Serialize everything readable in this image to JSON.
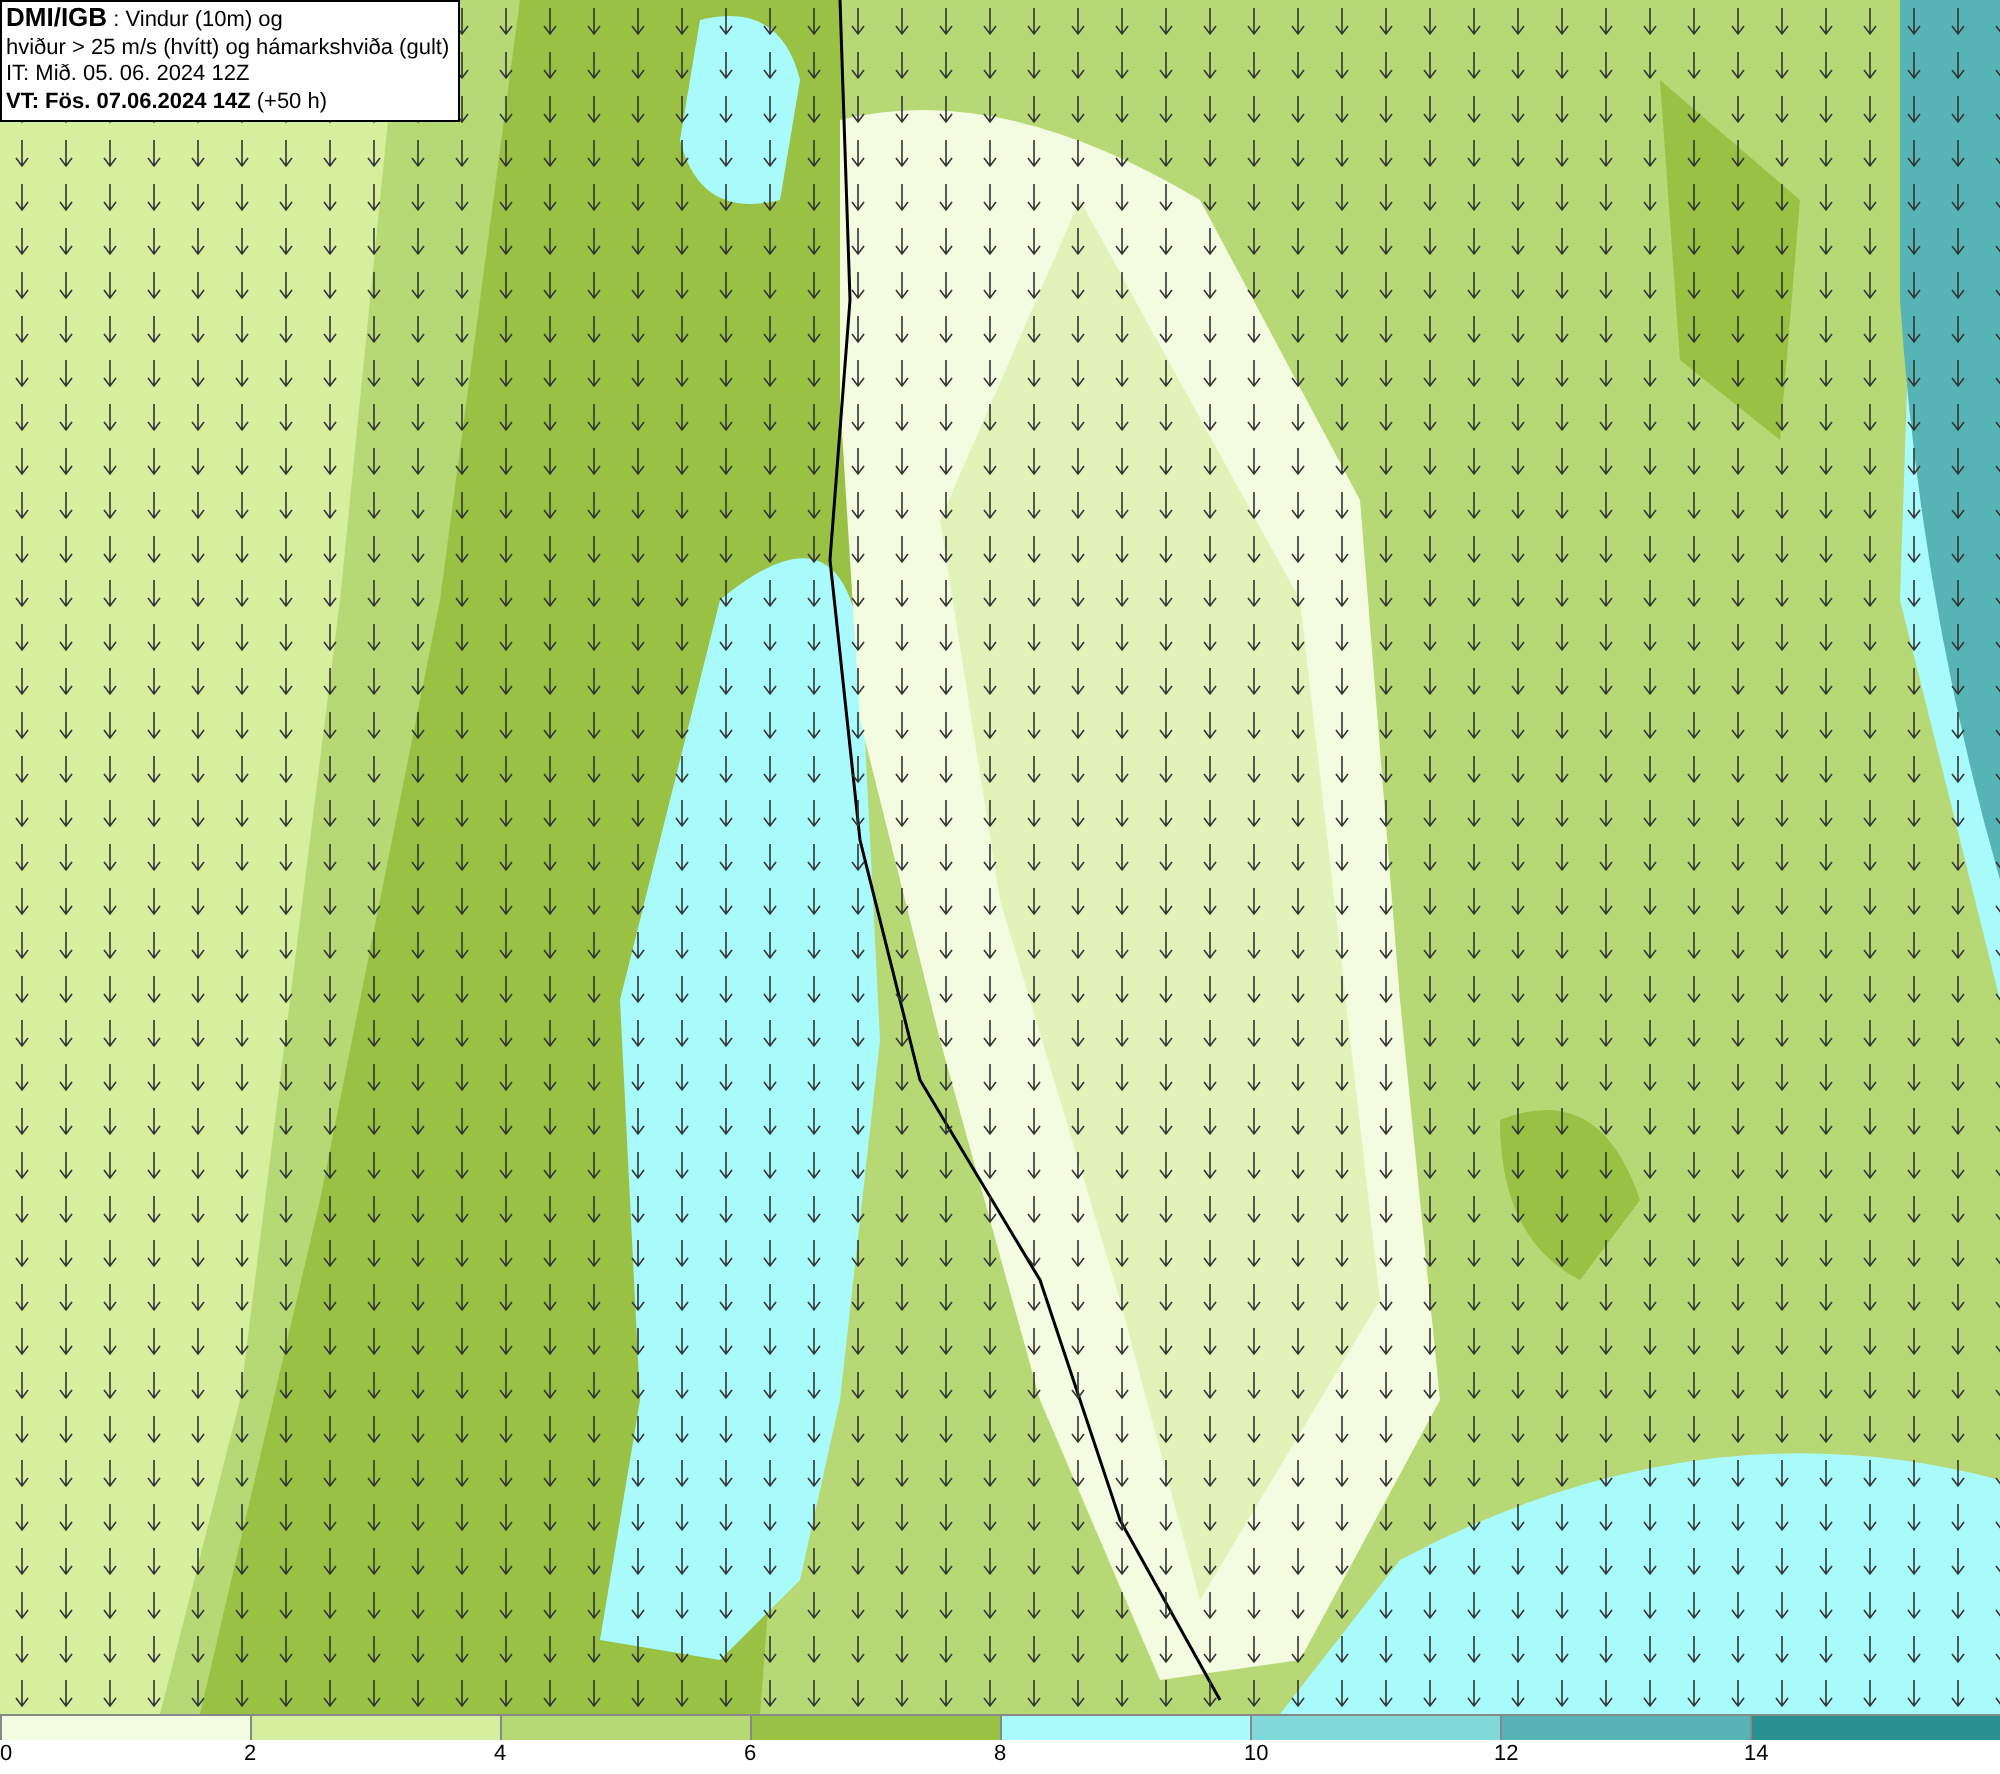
{
  "caption": {
    "lines": [
      "**DMI/IGB** : Vindur (10m) og",
      "hviður > 25 m/s (hvítt) og hámarkshviða (gult)",
      "IT: Mið. 05. 06. 2024 12Z",
      "**VT: Fös. 07.06.2024 14Z** (+50 h)"
    ]
  },
  "legend": {
    "bins": [
      {
        "color": "#f3fbe0",
        "label": "0"
      },
      {
        "color": "#d6ef9e",
        "label": "2"
      },
      {
        "color": "#b6d975",
        "label": "4"
      },
      {
        "color": "#99c144",
        "label": "6"
      },
      {
        "color": "#a9fbfb",
        "label": "8"
      },
      {
        "color": "#80d8d8",
        "label": "10"
      },
      {
        "color": "#56b4b4",
        "label": "12"
      },
      {
        "color": "#2a9090",
        "label": "14"
      }
    ]
  }
}
